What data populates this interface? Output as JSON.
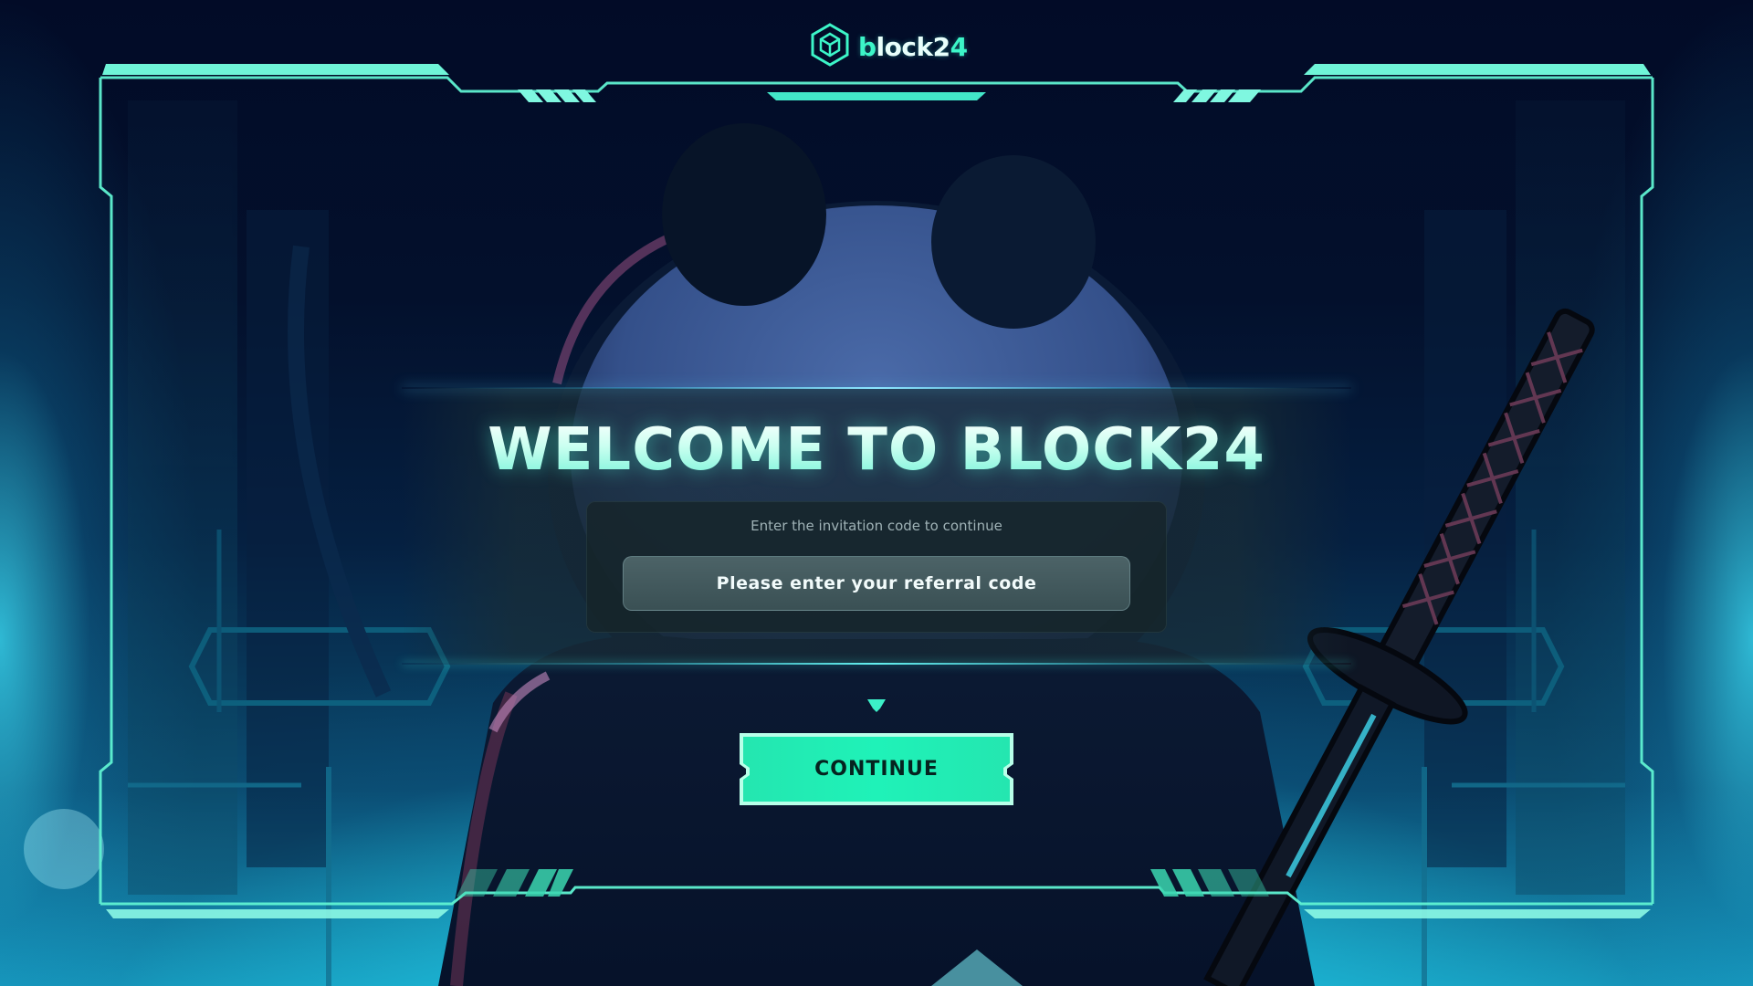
{
  "app": {
    "logo_text_b": "b",
    "logo_text_rest": "lock2",
    "logo_text_4": "4",
    "logo_icon": "hexagon-cube-icon"
  },
  "welcome": {
    "title": "WELCOME TO BLOCK24"
  },
  "invite": {
    "hint": "Enter the invitation code to continue",
    "input_value": "",
    "input_placeholder": "Please enter your referral code"
  },
  "actions": {
    "continue_label": "CONTINUE",
    "continue_arrow_icon": "triangle-down-icon"
  },
  "colors": {
    "accent": "#3cf5c8",
    "frame": "#5ff2d2",
    "background": "#020b24",
    "button": "#1ef0b4"
  },
  "background_art": {
    "subject": "ninja-panda-character-icon",
    "prop": "katana-sword-icon"
  }
}
